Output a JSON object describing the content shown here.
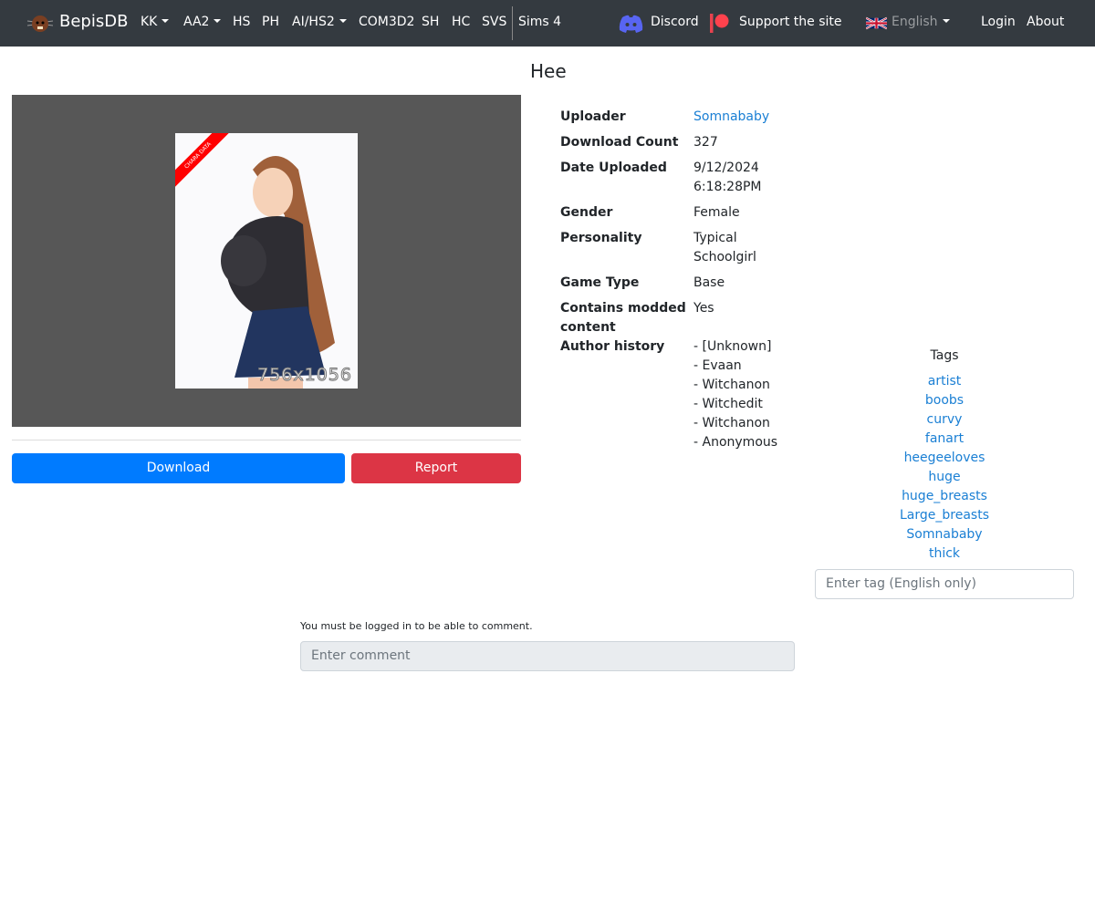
{
  "nav": {
    "brand": "BepisDB",
    "items": [
      {
        "label": "KK",
        "dropdown": true
      },
      {
        "label": "AA2",
        "dropdown": true
      },
      {
        "label": "HS"
      },
      {
        "label": "PH"
      },
      {
        "label": "AI/HS2",
        "dropdown": true
      },
      {
        "label": "COM3D2"
      },
      {
        "label": "SH"
      },
      {
        "label": "HC"
      },
      {
        "label": "SVS"
      },
      {
        "label": "Sims 4"
      }
    ],
    "discord": "Discord",
    "support": "Support the site",
    "language": "English",
    "login": "Login",
    "about": "About"
  },
  "card": {
    "title": "Hee",
    "ribbon": "CHARA DATA",
    "dimensions": "756x1056",
    "download": "Download",
    "report": "Report"
  },
  "info": {
    "uploader_label": "Uploader",
    "uploader": "Somnababy",
    "downloads_label": "Download Count",
    "downloads": "327",
    "date_label": "Date Uploaded",
    "date": "9/12/2024 6:18:28PM",
    "gender_label": "Gender",
    "gender": "Female",
    "personality_label": "Personality",
    "personality": "Typical Schoolgirl",
    "gametype_label": "Game Type",
    "gametype": "Base",
    "modded_label": "Contains modded content",
    "modded": "Yes",
    "author_label": "Author history",
    "authors": [
      "- [Unknown]",
      "- Evaan",
      "- Witchanon",
      "- Witchedit",
      "- Witchanon",
      "- Anonymous"
    ]
  },
  "tags": {
    "heading": "Tags",
    "items": [
      "artist",
      "boobs",
      "curvy",
      "fanart",
      "heegeeloves",
      "huge",
      "huge_breasts",
      "Large_breasts",
      "Somnababy",
      "thick"
    ],
    "placeholder": "Enter tag (English only)"
  },
  "comments": {
    "note": "You must be logged in to be able to comment.",
    "placeholder": "Enter comment"
  },
  "colors": {
    "primary": "#007bff",
    "danger": "#dc3545",
    "navbar": "#343a40",
    "link": "#1a7fd4"
  }
}
